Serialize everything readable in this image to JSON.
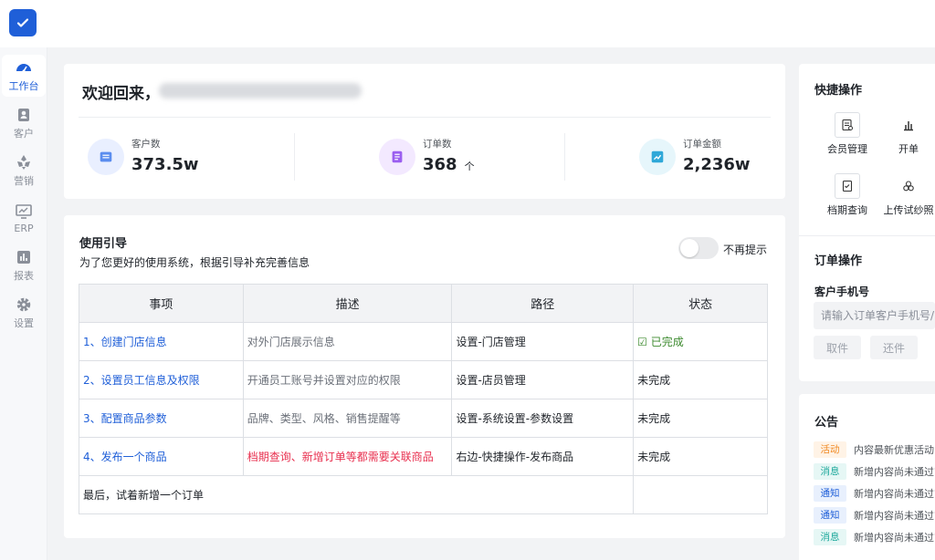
{
  "nav": [
    {
      "label": "工作台",
      "icon": "dashboard-icon",
      "active": true
    },
    {
      "label": "客户",
      "icon": "customer-icon"
    },
    {
      "label": "营销",
      "icon": "marketing-icon"
    },
    {
      "label": "ERP",
      "icon": "erp-icon"
    },
    {
      "label": "报表",
      "icon": "report-icon"
    },
    {
      "label": "设置",
      "icon": "gear-icon"
    }
  ],
  "welcome": {
    "title": "欢迎回来，",
    "stats": [
      {
        "label": "客户数",
        "value": "373.5w",
        "unit": ""
      },
      {
        "label": "订单数",
        "value": "368",
        "unit": "个"
      },
      {
        "label": "订单金额",
        "value": "2,236w",
        "unit": ""
      }
    ]
  },
  "guide": {
    "title": "使用引导",
    "subtitle": "为了您更好的使用系统，根据引导补充完善信息",
    "toggle_label": "不再提示",
    "columns": [
      "事项",
      "描述",
      "路径",
      "状态"
    ],
    "rows": [
      {
        "item": "1、创建门店信息",
        "desc": "对外门店展示信息",
        "path": "设置-门店管理",
        "status": "☑ 已完成"
      },
      {
        "item": "2、设置员工信息及权限",
        "desc": "开通员工账号并设置对应的权限",
        "path": "设置-店员管理",
        "status": "未完成"
      },
      {
        "item": "3、配置商品参数",
        "desc": "品牌、类型、风格、销售提醒等",
        "path": "设置-系统设置-参数设置",
        "status": "未完成"
      },
      {
        "item": "4、发布一个商品",
        "desc": "档期查询、新增订单等都需要关联商品",
        "path": "右边-快捷操作-发布商品",
        "status": "未完成"
      }
    ],
    "footer": "最后，试着新增一个订单"
  },
  "quick_ops": {
    "title": "快捷操作",
    "items": [
      {
        "label": "会员管理",
        "icon": "member-card-icon"
      },
      {
        "label": "开单",
        "icon": "bar-chart-icon"
      },
      {
        "label": "档期查询",
        "icon": "schedule-icon"
      },
      {
        "label": "上传试纱照",
        "icon": "upload-photo-icon"
      }
    ]
  },
  "order_ops": {
    "title": "订单操作",
    "phone_label": "客户手机号",
    "phone_placeholder": "请输入订单客户手机号/",
    "take_label": "取件",
    "return_label": "还件"
  },
  "notices": {
    "title": "公告",
    "items": [
      {
        "tag": "活动",
        "text": "内容最新优惠活动",
        "color": "#f08a24",
        "bg": "#fff3e6"
      },
      {
        "tag": "消息",
        "text": "新增内容尚未通过审",
        "color": "#1aa79a",
        "bg": "#e6f7f5"
      },
      {
        "tag": "通知",
        "text": "新增内容尚未通过审",
        "color": "#1f5fd8",
        "bg": "#e8f0fd"
      },
      {
        "tag": "通知",
        "text": "新增内容尚未通过审",
        "color": "#1f5fd8",
        "bg": "#e8f0fd"
      },
      {
        "tag": "消息",
        "text": "新增内容尚未通过审",
        "color": "#1aa79a",
        "bg": "#e6f7f5"
      }
    ]
  },
  "colors": {
    "accent": "#1f5fd8",
    "danger": "#e8304f",
    "success": "#3c8a2e"
  }
}
